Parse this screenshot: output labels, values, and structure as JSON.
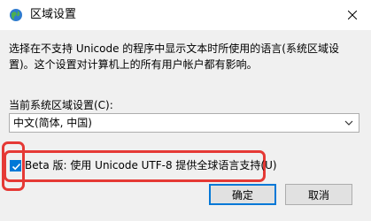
{
  "window": {
    "title": "区域设置",
    "icon": "globe-icon",
    "close_icon": "close-icon"
  },
  "description": "选择在不支持 Unicode 的程序中显示文本时所使用的语言(系统区域设置)。这个设置对计算机上的所有用户帐户都有影响。",
  "locale": {
    "label": "当前系统区域设置(C):",
    "value": "中文(简体, 中国)"
  },
  "beta_option": {
    "label": "Beta 版: 使用 Unicode UTF-8 提供全球语言支持(U)",
    "checked": true
  },
  "buttons": {
    "ok": "确定",
    "cancel": "取消"
  },
  "colors": {
    "accent": "#0078d7",
    "highlight": "#e53935"
  }
}
